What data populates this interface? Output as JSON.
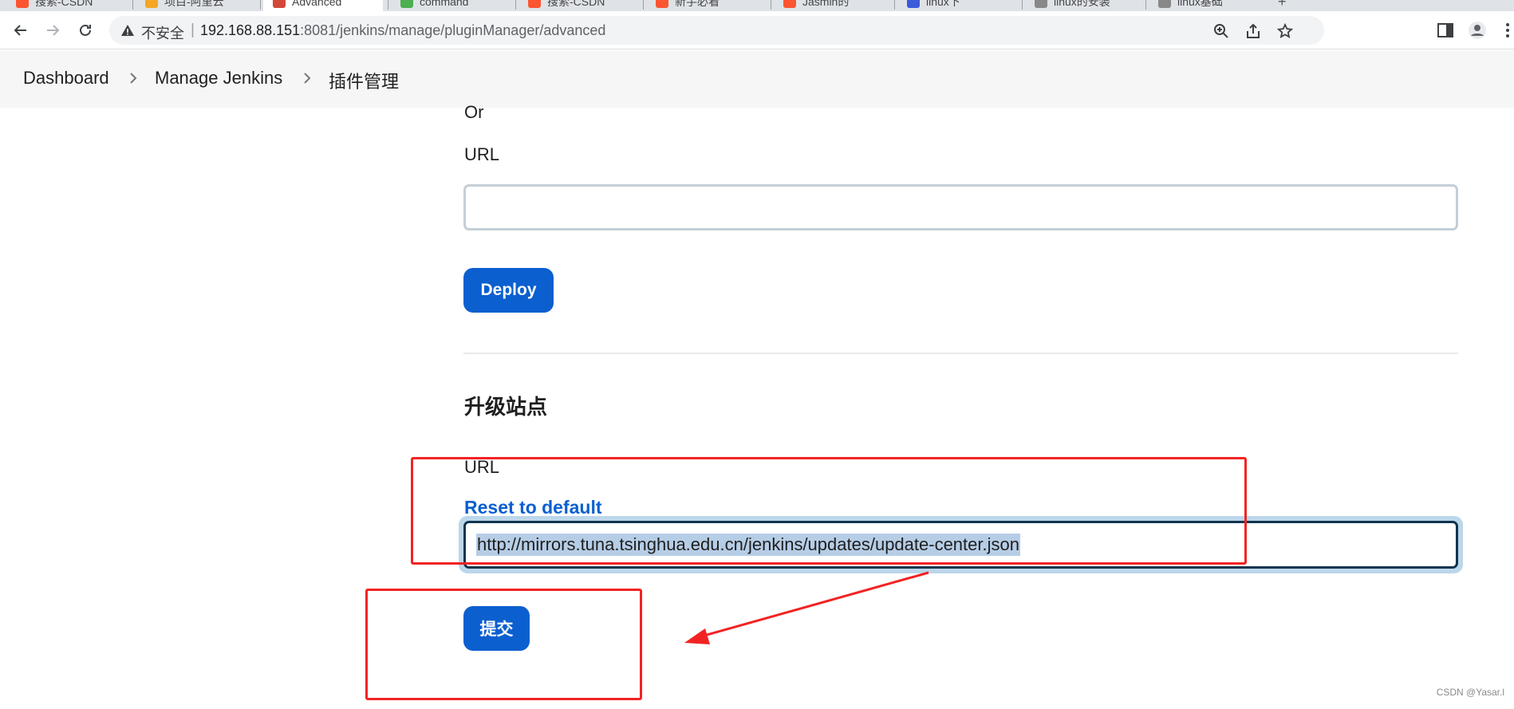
{
  "browser": {
    "tabs": [
      {
        "title": "搜索-CSDN",
        "favicon_color": "#fc5531"
      },
      {
        "title": "项目-阿里云",
        "favicon_color": "#f5a623"
      },
      {
        "title": "Advanced",
        "favicon_color": "#d24939",
        "active": true
      },
      {
        "title": "command",
        "favicon_color": "#4caf50"
      },
      {
        "title": "搜索-CSDN",
        "favicon_color": "#fc5531"
      },
      {
        "title": "新手必看",
        "favicon_color": "#fc5531"
      },
      {
        "title": "Jasmin的",
        "favicon_color": "#fc5531"
      },
      {
        "title": "linux下",
        "favicon_color": "#3b5bdb"
      },
      {
        "title": "linux的安装",
        "favicon_color": "#888888"
      },
      {
        "title": "linux基础",
        "favicon_color": "#888888"
      }
    ],
    "new_tab_label": "+",
    "security_label": "不安全",
    "separator": "|",
    "url_host": "192.168.88.151",
    "url_rest": ":8081/jenkins/manage/pluginManager/advanced"
  },
  "breadcrumb": {
    "items": [
      "Dashboard",
      "Manage Jenkins",
      "插件管理"
    ]
  },
  "deploy_section": {
    "or_label": "Or",
    "url_label": "URL",
    "url_value": "",
    "deploy_button": "Deploy"
  },
  "update_site": {
    "title": "升级站点",
    "url_label": "URL",
    "reset_link": "Reset to default",
    "url_value": "http://mirrors.tuna.tsinghua.edu.cn/jenkins/updates/update-center.json",
    "submit_button": "提交"
  },
  "colors": {
    "primary": "#0b5fcf",
    "annotation": "#f22323"
  },
  "watermark": "CSDN @Yasar.l"
}
